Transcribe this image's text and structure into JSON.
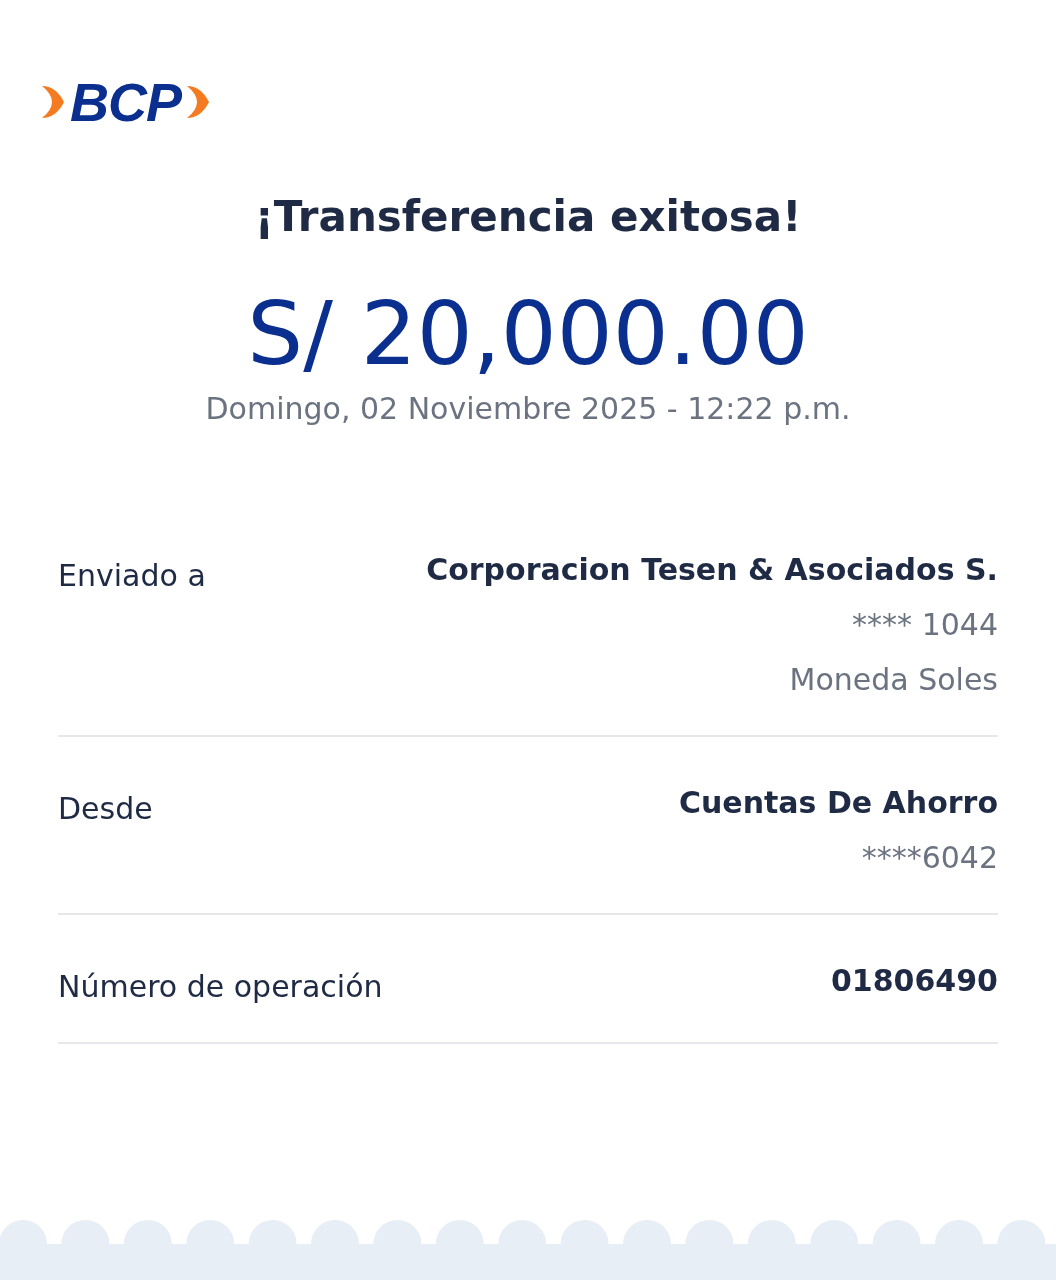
{
  "logo": {
    "text": "BCP"
  },
  "title": "¡Transferencia exitosa!",
  "amount": "S/ 20,000.00",
  "date": "Domingo, 02 Noviembre 2025 - 12:22 p.m.",
  "details": [
    {
      "label": "Enviado a",
      "value": "Corporacion Tesen & Asociados S.",
      "sub": [
        "**** 1044",
        "Moneda Soles"
      ]
    },
    {
      "label": "Desde",
      "value": "Cuentas De Ahorro",
      "sub": [
        "****6042"
      ]
    },
    {
      "label": "Número de operación",
      "value": "01806490"
    }
  ]
}
